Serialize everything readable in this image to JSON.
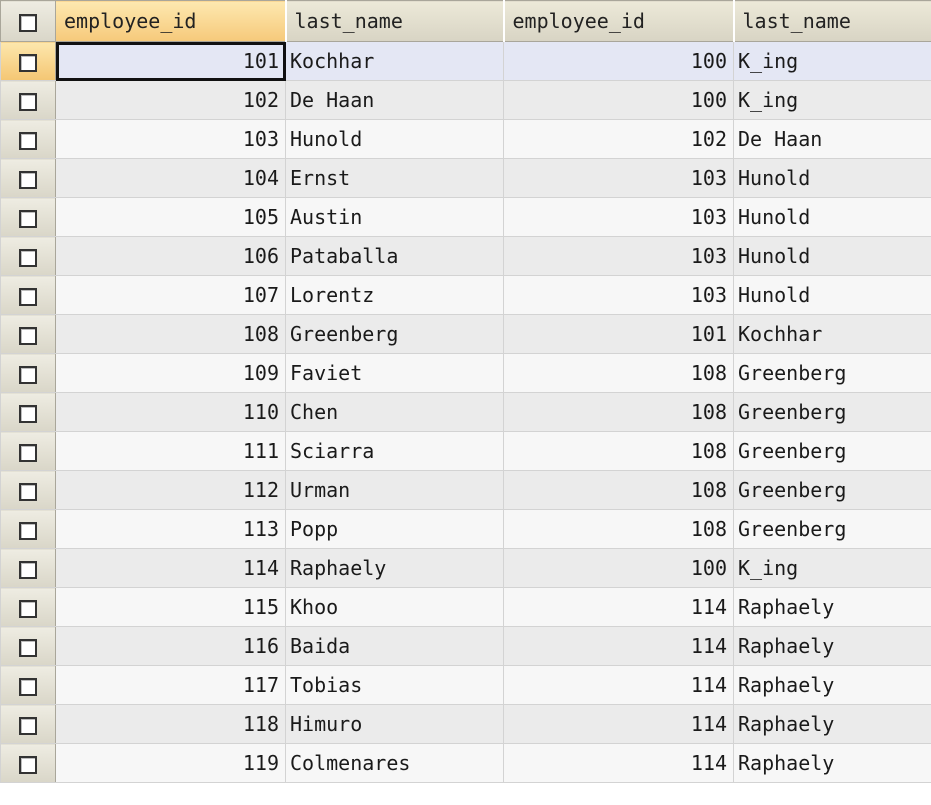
{
  "columns": [
    {
      "key": "employee_id",
      "label": "employee_id",
      "align": "right"
    },
    {
      "key": "last_name",
      "label": "last_name",
      "align": "left"
    },
    {
      "key": "employee_id",
      "label": "employee_id",
      "align": "right"
    },
    {
      "key": "last_name",
      "label": "last_name",
      "align": "left"
    }
  ],
  "current_row": 0,
  "rows": [
    [
      "101",
      "Kochhar",
      "100",
      "K_ing"
    ],
    [
      "102",
      "De Haan",
      "100",
      "K_ing"
    ],
    [
      "103",
      "Hunold",
      "102",
      "De Haan"
    ],
    [
      "104",
      "Ernst",
      "103",
      "Hunold"
    ],
    [
      "105",
      "Austin",
      "103",
      "Hunold"
    ],
    [
      "106",
      "Pataballa",
      "103",
      "Hunold"
    ],
    [
      "107",
      "Lorentz",
      "103",
      "Hunold"
    ],
    [
      "108",
      "Greenberg",
      "101",
      "Kochhar"
    ],
    [
      "109",
      "Faviet",
      "108",
      "Greenberg"
    ],
    [
      "110",
      "Chen",
      "108",
      "Greenberg"
    ],
    [
      "111",
      "Sciarra",
      "108",
      "Greenberg"
    ],
    [
      "112",
      "Urman",
      "108",
      "Greenberg"
    ],
    [
      "113",
      "Popp",
      "108",
      "Greenberg"
    ],
    [
      "114",
      "Raphaely",
      "100",
      "K_ing"
    ],
    [
      "115",
      "Khoo",
      "114",
      "Raphaely"
    ],
    [
      "116",
      "Baida",
      "114",
      "Raphaely"
    ],
    [
      "117",
      "Tobias",
      "114",
      "Raphaely"
    ],
    [
      "118",
      "Himuro",
      "114",
      "Raphaely"
    ],
    [
      "119",
      "Colmenares",
      "114",
      "Raphaely"
    ]
  ]
}
